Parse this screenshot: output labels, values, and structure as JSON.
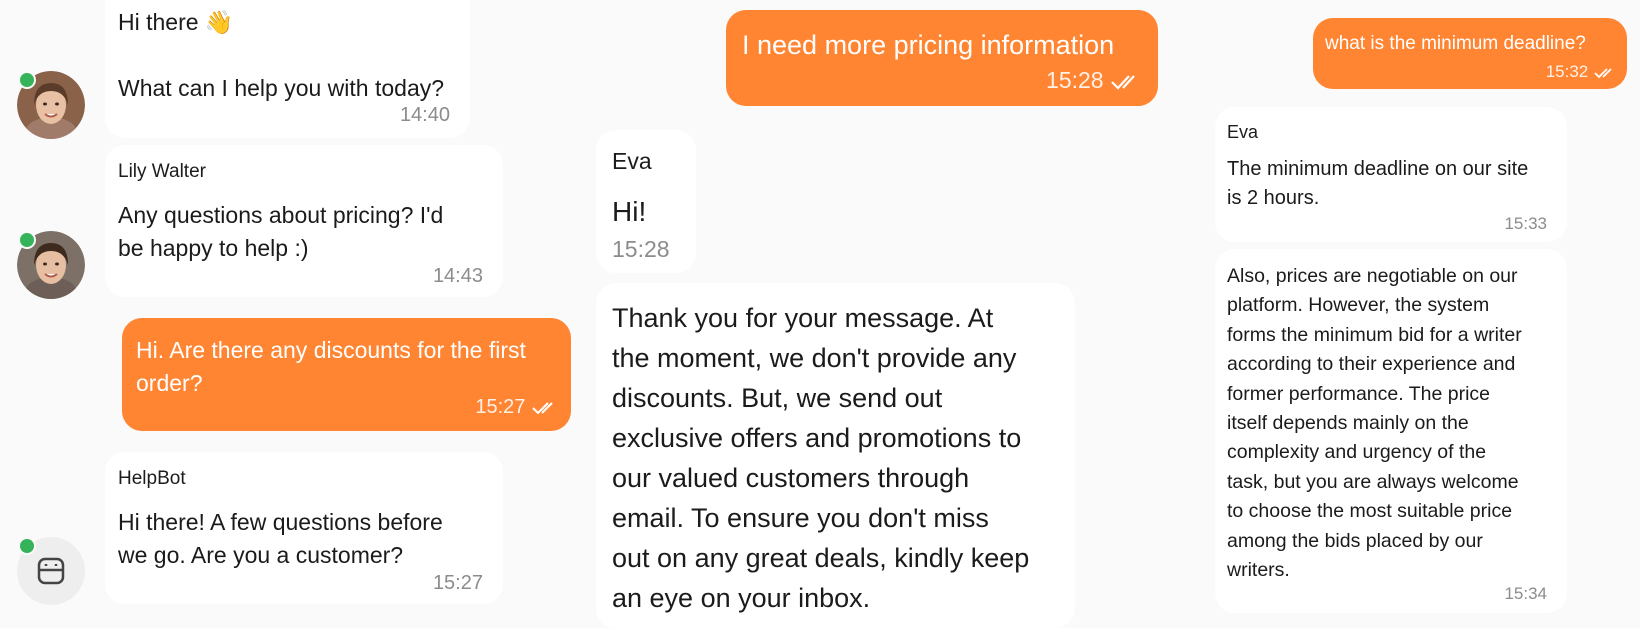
{
  "column1": {
    "greeting": {
      "text": "Hi there 👋\n\nWhat can I help you with today?",
      "time": "14:40"
    },
    "lily_message": {
      "sender": "Lily Walter",
      "text": "Any questions about pricing? I'd\nbe happy to help :)",
      "time": "14:43"
    },
    "user_message": {
      "text": "Hi. Are there any discounts for the first\norder?",
      "time": "15:27"
    },
    "helpbot_message": {
      "sender": "HelpBot",
      "text": "Hi there! A few questions before\nwe go. Are you a customer?",
      "time": "15:27"
    }
  },
  "column2": {
    "user_message": {
      "text": "I need more pricing information",
      "time": "15:28"
    },
    "eva_hi": {
      "sender": "Eva",
      "text": "Hi!",
      "time": "15:28"
    },
    "eva_reply": {
      "text": "Thank you for your message. At\nthe moment, we don't provide any\ndiscounts. But, we send out\nexclusive offers and promotions to\nour valued customers through\nemail. To ensure you don't miss\nout on any great deals, kindly keep\nan eye on your inbox."
    }
  },
  "column3": {
    "user_message": {
      "text": "what is the minimum deadline?",
      "time": "15:32"
    },
    "eva_deadline": {
      "sender": "Eva",
      "text": "The minimum deadline on our site\nis 2 hours.",
      "time": "15:33"
    },
    "eva_prices": {
      "text": "Also, prices are negotiable on our\nplatform. However, the system\nforms the minimum bid for a writer\naccording to their experience and\nformer performance. The price\nitself depends mainly on the\ncomplexity and urgency of the\ntask, but you are always welcome\nto choose the most suitable price\namong the bids placed by our\nwriters.",
      "time": "15:34"
    }
  },
  "colors": {
    "outgoing_bubble": "#ff8532",
    "incoming_bubble": "#ffffff",
    "background": "#fafafa",
    "online_dot": "#35b35a",
    "timestamp": "#8c8c8c"
  },
  "icons": {
    "read_receipt": "double-check-icon",
    "bot_avatar": "robot-icon"
  }
}
